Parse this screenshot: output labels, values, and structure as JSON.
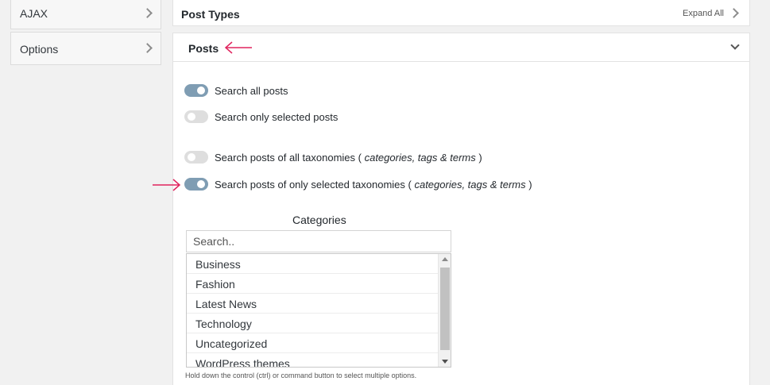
{
  "sidebar": {
    "items": [
      {
        "label": "AJAX"
      },
      {
        "label": "Options"
      }
    ]
  },
  "post_types": {
    "title": "Post Types",
    "expand_all": "Expand All"
  },
  "posts": {
    "title": "Posts",
    "options": [
      {
        "text": "Search all posts",
        "on": true
      },
      {
        "text": "Search only selected posts",
        "on": false
      },
      {
        "text": "Search posts of all taxonomies ( ",
        "italic": "categories, tags & terms",
        "close": " )",
        "on": false
      },
      {
        "text": "Search posts of only selected taxonomies ( ",
        "italic": "categories, tags & terms",
        "close": " )",
        "on": true
      }
    ],
    "categories": {
      "label": "Categories",
      "search_placeholder": "Search..",
      "items": [
        "Business",
        "Fashion",
        "Latest News",
        "Technology",
        "Uncategorized",
        "WordPress themes"
      ],
      "help": "Hold down the control (ctrl) or command button to select multiple options."
    }
  },
  "colors": {
    "annotation_arrow": "#e0245e",
    "toggle_on": "#7f9db3",
    "toggle_off": "#dedede"
  }
}
